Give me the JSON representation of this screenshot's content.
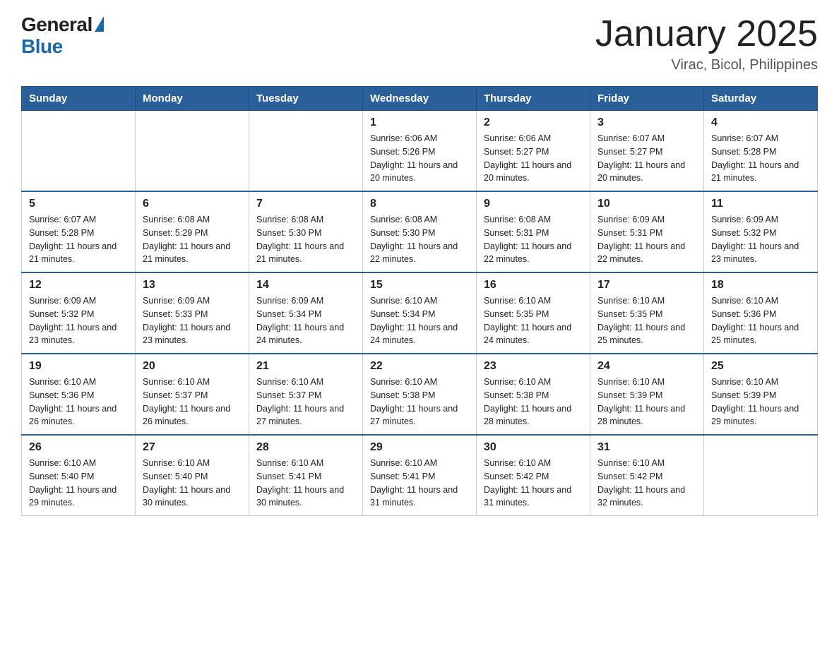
{
  "header": {
    "logo_general": "General",
    "logo_blue": "Blue",
    "title": "January 2025",
    "subtitle": "Virac, Bicol, Philippines"
  },
  "days_of_week": [
    "Sunday",
    "Monday",
    "Tuesday",
    "Wednesday",
    "Thursday",
    "Friday",
    "Saturday"
  ],
  "weeks": [
    [
      {
        "day": "",
        "info": ""
      },
      {
        "day": "",
        "info": ""
      },
      {
        "day": "",
        "info": ""
      },
      {
        "day": "1",
        "info": "Sunrise: 6:06 AM\nSunset: 5:26 PM\nDaylight: 11 hours\nand 20 minutes."
      },
      {
        "day": "2",
        "info": "Sunrise: 6:06 AM\nSunset: 5:27 PM\nDaylight: 11 hours\nand 20 minutes."
      },
      {
        "day": "3",
        "info": "Sunrise: 6:07 AM\nSunset: 5:27 PM\nDaylight: 11 hours\nand 20 minutes."
      },
      {
        "day": "4",
        "info": "Sunrise: 6:07 AM\nSunset: 5:28 PM\nDaylight: 11 hours\nand 21 minutes."
      }
    ],
    [
      {
        "day": "5",
        "info": "Sunrise: 6:07 AM\nSunset: 5:28 PM\nDaylight: 11 hours\nand 21 minutes."
      },
      {
        "day": "6",
        "info": "Sunrise: 6:08 AM\nSunset: 5:29 PM\nDaylight: 11 hours\nand 21 minutes."
      },
      {
        "day": "7",
        "info": "Sunrise: 6:08 AM\nSunset: 5:30 PM\nDaylight: 11 hours\nand 21 minutes."
      },
      {
        "day": "8",
        "info": "Sunrise: 6:08 AM\nSunset: 5:30 PM\nDaylight: 11 hours\nand 22 minutes."
      },
      {
        "day": "9",
        "info": "Sunrise: 6:08 AM\nSunset: 5:31 PM\nDaylight: 11 hours\nand 22 minutes."
      },
      {
        "day": "10",
        "info": "Sunrise: 6:09 AM\nSunset: 5:31 PM\nDaylight: 11 hours\nand 22 minutes."
      },
      {
        "day": "11",
        "info": "Sunrise: 6:09 AM\nSunset: 5:32 PM\nDaylight: 11 hours\nand 23 minutes."
      }
    ],
    [
      {
        "day": "12",
        "info": "Sunrise: 6:09 AM\nSunset: 5:32 PM\nDaylight: 11 hours\nand 23 minutes."
      },
      {
        "day": "13",
        "info": "Sunrise: 6:09 AM\nSunset: 5:33 PM\nDaylight: 11 hours\nand 23 minutes."
      },
      {
        "day": "14",
        "info": "Sunrise: 6:09 AM\nSunset: 5:34 PM\nDaylight: 11 hours\nand 24 minutes."
      },
      {
        "day": "15",
        "info": "Sunrise: 6:10 AM\nSunset: 5:34 PM\nDaylight: 11 hours\nand 24 minutes."
      },
      {
        "day": "16",
        "info": "Sunrise: 6:10 AM\nSunset: 5:35 PM\nDaylight: 11 hours\nand 24 minutes."
      },
      {
        "day": "17",
        "info": "Sunrise: 6:10 AM\nSunset: 5:35 PM\nDaylight: 11 hours\nand 25 minutes."
      },
      {
        "day": "18",
        "info": "Sunrise: 6:10 AM\nSunset: 5:36 PM\nDaylight: 11 hours\nand 25 minutes."
      }
    ],
    [
      {
        "day": "19",
        "info": "Sunrise: 6:10 AM\nSunset: 5:36 PM\nDaylight: 11 hours\nand 26 minutes."
      },
      {
        "day": "20",
        "info": "Sunrise: 6:10 AM\nSunset: 5:37 PM\nDaylight: 11 hours\nand 26 minutes."
      },
      {
        "day": "21",
        "info": "Sunrise: 6:10 AM\nSunset: 5:37 PM\nDaylight: 11 hours\nand 27 minutes."
      },
      {
        "day": "22",
        "info": "Sunrise: 6:10 AM\nSunset: 5:38 PM\nDaylight: 11 hours\nand 27 minutes."
      },
      {
        "day": "23",
        "info": "Sunrise: 6:10 AM\nSunset: 5:38 PM\nDaylight: 11 hours\nand 28 minutes."
      },
      {
        "day": "24",
        "info": "Sunrise: 6:10 AM\nSunset: 5:39 PM\nDaylight: 11 hours\nand 28 minutes."
      },
      {
        "day": "25",
        "info": "Sunrise: 6:10 AM\nSunset: 5:39 PM\nDaylight: 11 hours\nand 29 minutes."
      }
    ],
    [
      {
        "day": "26",
        "info": "Sunrise: 6:10 AM\nSunset: 5:40 PM\nDaylight: 11 hours\nand 29 minutes."
      },
      {
        "day": "27",
        "info": "Sunrise: 6:10 AM\nSunset: 5:40 PM\nDaylight: 11 hours\nand 30 minutes."
      },
      {
        "day": "28",
        "info": "Sunrise: 6:10 AM\nSunset: 5:41 PM\nDaylight: 11 hours\nand 30 minutes."
      },
      {
        "day": "29",
        "info": "Sunrise: 6:10 AM\nSunset: 5:41 PM\nDaylight: 11 hours\nand 31 minutes."
      },
      {
        "day": "30",
        "info": "Sunrise: 6:10 AM\nSunset: 5:42 PM\nDaylight: 11 hours\nand 31 minutes."
      },
      {
        "day": "31",
        "info": "Sunrise: 6:10 AM\nSunset: 5:42 PM\nDaylight: 11 hours\nand 32 minutes."
      },
      {
        "day": "",
        "info": ""
      }
    ]
  ]
}
